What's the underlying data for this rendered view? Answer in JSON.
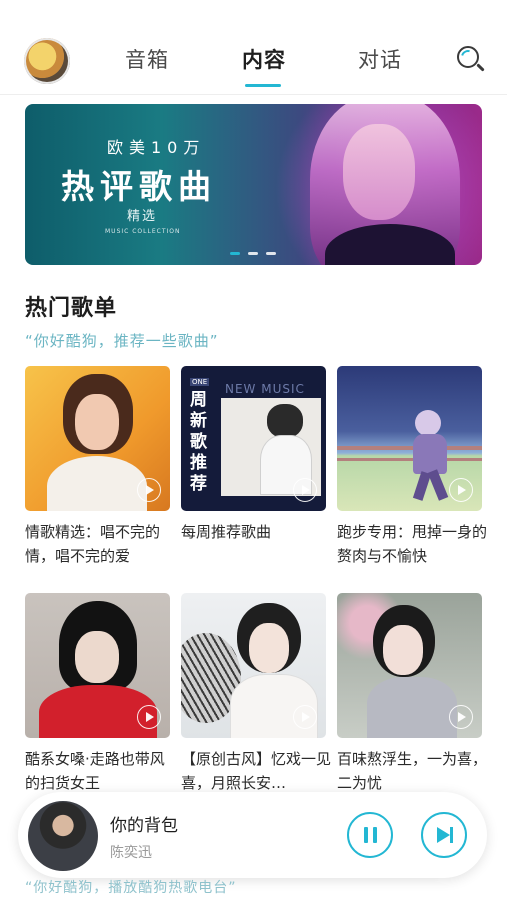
{
  "header": {
    "tabs": [
      {
        "label": "音箱",
        "active": false
      },
      {
        "label": "内容",
        "active": true
      },
      {
        "label": "对话",
        "active": false
      }
    ],
    "search_icon": "search-icon",
    "accent": "#23b7d3"
  },
  "banner": {
    "subtitle": "欧美10万",
    "title": "热评歌曲",
    "tag": "精选",
    "small": "MUSIC COLLECTION",
    "dots_total": 3,
    "dots_active": 1
  },
  "section": {
    "title": "热门歌单",
    "subtitle": "“你好酷狗，推荐一些歌曲”"
  },
  "playlists": [
    {
      "label": "情歌精选：唱不完的情，唱不完的爱",
      "play_icon": "play-icon"
    },
    {
      "label": "每周推荐歌曲",
      "cover_text_side": "周新歌推荐",
      "cover_text_top": "NEW MUSIC",
      "cover_badge": "ONE",
      "play_icon": "play-icon"
    },
    {
      "label": "跑步专用：甩掉一身的赘肉与不愉快",
      "play_icon": "play-icon"
    },
    {
      "label": "酷系女嗓·走路也带风的扫货女王",
      "play_icon": "play-icon"
    },
    {
      "label": "【原创古风】忆戏一见喜，月照长安…",
      "play_icon": "play-icon"
    },
    {
      "label": "百味熬浮生，一为喜，二为忧",
      "play_icon": "play-icon"
    }
  ],
  "player": {
    "title": "你的背包",
    "artist": "陈奕迅",
    "pause_icon": "pause-icon",
    "next_icon": "next-icon"
  },
  "hint": "“你好酷狗，播放酷狗热歌电台”"
}
